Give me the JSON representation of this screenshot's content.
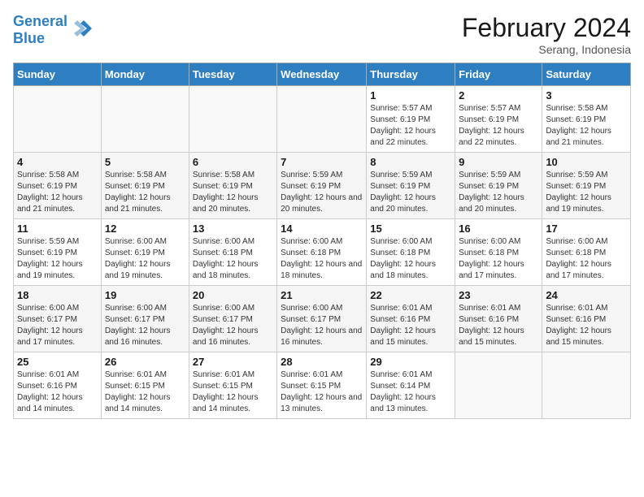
{
  "header": {
    "logo_general": "General",
    "logo_blue": "Blue",
    "month_title": "February 2024",
    "location": "Serang, Indonesia"
  },
  "days_of_week": [
    "Sunday",
    "Monday",
    "Tuesday",
    "Wednesday",
    "Thursday",
    "Friday",
    "Saturday"
  ],
  "weeks": [
    [
      {
        "day": "",
        "info": ""
      },
      {
        "day": "",
        "info": ""
      },
      {
        "day": "",
        "info": ""
      },
      {
        "day": "",
        "info": ""
      },
      {
        "day": "1",
        "info": "Sunrise: 5:57 AM\nSunset: 6:19 PM\nDaylight: 12 hours and 22 minutes."
      },
      {
        "day": "2",
        "info": "Sunrise: 5:57 AM\nSunset: 6:19 PM\nDaylight: 12 hours and 22 minutes."
      },
      {
        "day": "3",
        "info": "Sunrise: 5:58 AM\nSunset: 6:19 PM\nDaylight: 12 hours and 21 minutes."
      }
    ],
    [
      {
        "day": "4",
        "info": "Sunrise: 5:58 AM\nSunset: 6:19 PM\nDaylight: 12 hours and 21 minutes."
      },
      {
        "day": "5",
        "info": "Sunrise: 5:58 AM\nSunset: 6:19 PM\nDaylight: 12 hours and 21 minutes."
      },
      {
        "day": "6",
        "info": "Sunrise: 5:58 AM\nSunset: 6:19 PM\nDaylight: 12 hours and 20 minutes."
      },
      {
        "day": "7",
        "info": "Sunrise: 5:59 AM\nSunset: 6:19 PM\nDaylight: 12 hours and 20 minutes."
      },
      {
        "day": "8",
        "info": "Sunrise: 5:59 AM\nSunset: 6:19 PM\nDaylight: 12 hours and 20 minutes."
      },
      {
        "day": "9",
        "info": "Sunrise: 5:59 AM\nSunset: 6:19 PM\nDaylight: 12 hours and 20 minutes."
      },
      {
        "day": "10",
        "info": "Sunrise: 5:59 AM\nSunset: 6:19 PM\nDaylight: 12 hours and 19 minutes."
      }
    ],
    [
      {
        "day": "11",
        "info": "Sunrise: 5:59 AM\nSunset: 6:19 PM\nDaylight: 12 hours and 19 minutes."
      },
      {
        "day": "12",
        "info": "Sunrise: 6:00 AM\nSunset: 6:19 PM\nDaylight: 12 hours and 19 minutes."
      },
      {
        "day": "13",
        "info": "Sunrise: 6:00 AM\nSunset: 6:18 PM\nDaylight: 12 hours and 18 minutes."
      },
      {
        "day": "14",
        "info": "Sunrise: 6:00 AM\nSunset: 6:18 PM\nDaylight: 12 hours and 18 minutes."
      },
      {
        "day": "15",
        "info": "Sunrise: 6:00 AM\nSunset: 6:18 PM\nDaylight: 12 hours and 18 minutes."
      },
      {
        "day": "16",
        "info": "Sunrise: 6:00 AM\nSunset: 6:18 PM\nDaylight: 12 hours and 17 minutes."
      },
      {
        "day": "17",
        "info": "Sunrise: 6:00 AM\nSunset: 6:18 PM\nDaylight: 12 hours and 17 minutes."
      }
    ],
    [
      {
        "day": "18",
        "info": "Sunrise: 6:00 AM\nSunset: 6:17 PM\nDaylight: 12 hours and 17 minutes."
      },
      {
        "day": "19",
        "info": "Sunrise: 6:00 AM\nSunset: 6:17 PM\nDaylight: 12 hours and 16 minutes."
      },
      {
        "day": "20",
        "info": "Sunrise: 6:00 AM\nSunset: 6:17 PM\nDaylight: 12 hours and 16 minutes."
      },
      {
        "day": "21",
        "info": "Sunrise: 6:00 AM\nSunset: 6:17 PM\nDaylight: 12 hours and 16 minutes."
      },
      {
        "day": "22",
        "info": "Sunrise: 6:01 AM\nSunset: 6:16 PM\nDaylight: 12 hours and 15 minutes."
      },
      {
        "day": "23",
        "info": "Sunrise: 6:01 AM\nSunset: 6:16 PM\nDaylight: 12 hours and 15 minutes."
      },
      {
        "day": "24",
        "info": "Sunrise: 6:01 AM\nSunset: 6:16 PM\nDaylight: 12 hours and 15 minutes."
      }
    ],
    [
      {
        "day": "25",
        "info": "Sunrise: 6:01 AM\nSunset: 6:16 PM\nDaylight: 12 hours and 14 minutes."
      },
      {
        "day": "26",
        "info": "Sunrise: 6:01 AM\nSunset: 6:15 PM\nDaylight: 12 hours and 14 minutes."
      },
      {
        "day": "27",
        "info": "Sunrise: 6:01 AM\nSunset: 6:15 PM\nDaylight: 12 hours and 14 minutes."
      },
      {
        "day": "28",
        "info": "Sunrise: 6:01 AM\nSunset: 6:15 PM\nDaylight: 12 hours and 13 minutes."
      },
      {
        "day": "29",
        "info": "Sunrise: 6:01 AM\nSunset: 6:14 PM\nDaylight: 12 hours and 13 minutes."
      },
      {
        "day": "",
        "info": ""
      },
      {
        "day": "",
        "info": ""
      }
    ]
  ]
}
